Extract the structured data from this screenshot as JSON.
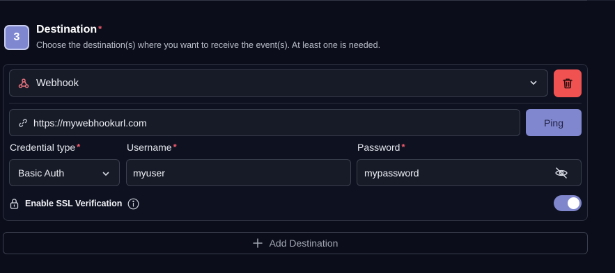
{
  "step": {
    "number": "3",
    "title": "Destination",
    "required_mark": "*",
    "description": "Choose the destination(s) where you want to receive the event(s). At least one is needed."
  },
  "destination": {
    "type_label": "Webhook",
    "type_icon": "webhook-icon",
    "delete_icon": "trash-icon",
    "url_icon": "link-icon",
    "url_value": "https://mywebhookurl.com",
    "ping_label": "Ping",
    "credential_type": {
      "label": "Credential type",
      "required_mark": "*",
      "value": "Basic Auth"
    },
    "username": {
      "label": "Username",
      "required_mark": "*",
      "value": "myuser"
    },
    "password": {
      "label": "Password",
      "required_mark": "*",
      "value": "mypassword",
      "toggle_icon": "eye-off-icon"
    },
    "ssl": {
      "label": "Enable SSL Verification",
      "icon": "lock-icon",
      "info_icon": "info-icon",
      "enabled": true
    }
  },
  "add_destination_label": "Add Destination",
  "colors": {
    "accent": "#8187cf",
    "danger": "#f05252",
    "required": "#ef5a6a",
    "background": "#0b0d1a"
  }
}
